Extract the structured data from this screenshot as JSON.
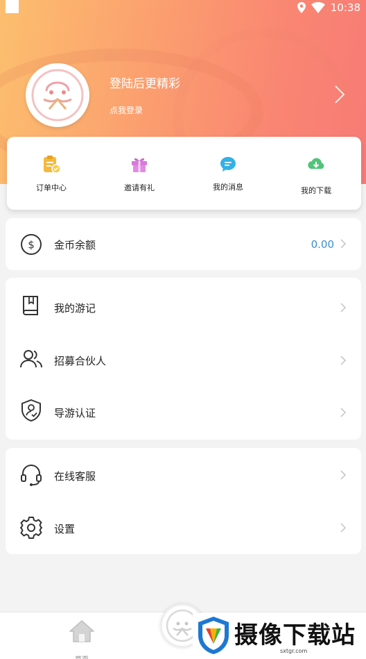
{
  "status_bar": {
    "time": "10:38"
  },
  "profile": {
    "login_title": "登陆后更精彩",
    "login_subtitle": "点我登录"
  },
  "quick_actions": [
    {
      "label": "订单中心",
      "icon": "clipboard-check-icon"
    },
    {
      "label": "邀请有礼",
      "icon": "gift-icon"
    },
    {
      "label": "我的消息",
      "icon": "message-bubble-icon"
    },
    {
      "label": "我的下载",
      "icon": "cloud-download-icon"
    }
  ],
  "balance": {
    "label": "金币余额",
    "value": "0.00"
  },
  "menu_group_1": [
    {
      "label": "我的游记",
      "icon": "book-icon"
    },
    {
      "label": "招募合伙人",
      "icon": "users-icon"
    },
    {
      "label": "导游认证",
      "icon": "shield-user-icon"
    }
  ],
  "menu_group_2": [
    {
      "label": "在线客服",
      "icon": "headset-icon"
    },
    {
      "label": "设置",
      "icon": "gear-icon"
    }
  ],
  "tabbar": {
    "home_label": "首页"
  },
  "watermark": {
    "text": "摄像下载站",
    "url": "sxtgr.com"
  },
  "colors": {
    "header_gradient_start": "#fcbf6e",
    "header_gradient_end": "#f77b76",
    "balance_value": "#3b8fc8"
  }
}
